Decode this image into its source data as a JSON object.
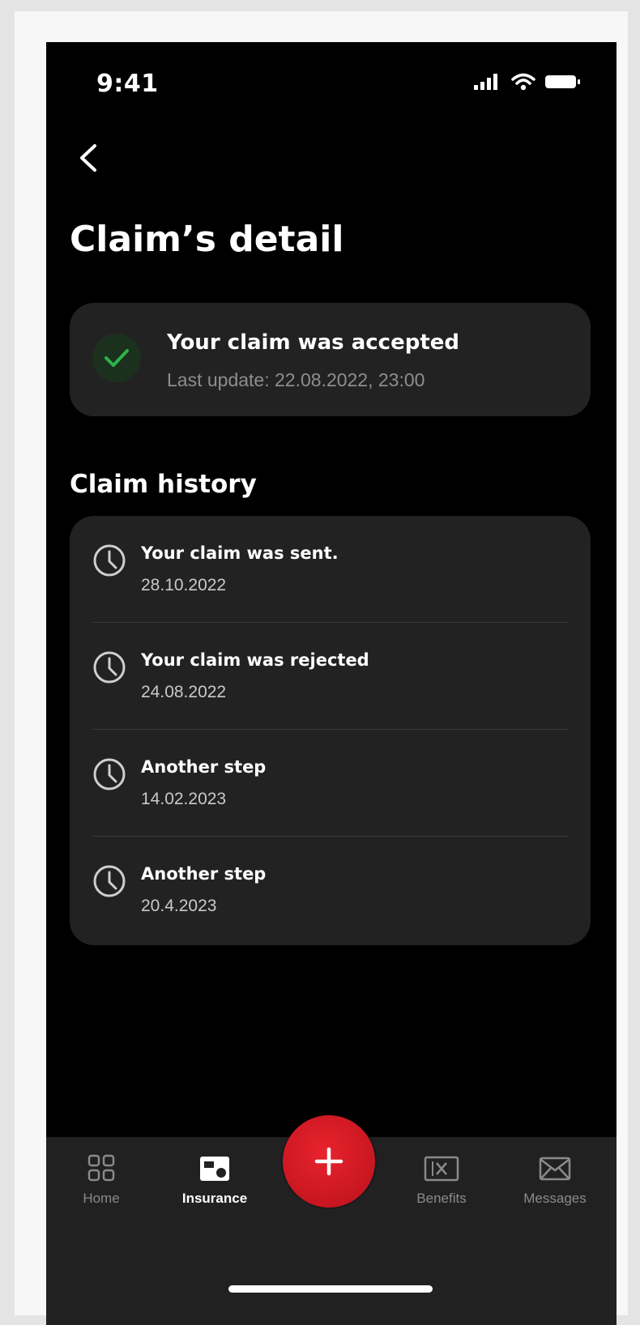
{
  "status_bar": {
    "time": "9:41"
  },
  "header": {
    "title": "Claim’s detail"
  },
  "claim_status": {
    "title": "Your claim was accepted",
    "subtitle": "Last update: 22.08.2022, 23:00",
    "icon": "check-icon",
    "accent": "#2bb44a"
  },
  "history": {
    "title": "Claim history",
    "items": [
      {
        "title": "Your claim was sent.",
        "date": "28.10.2022",
        "icon": "clock-icon"
      },
      {
        "title": "Your claim was rejected",
        "date": "24.08.2022",
        "icon": "clock-icon"
      },
      {
        "title": "Another step",
        "date": "14.02.2023",
        "icon": "clock-icon"
      },
      {
        "title": "Another step",
        "date": "20.4.2023",
        "icon": "clock-icon"
      }
    ]
  },
  "tabbar": {
    "items": [
      {
        "label": "Home",
        "icon": "grid-icon",
        "active": false
      },
      {
        "label": "Insurance",
        "icon": "insurance-icon",
        "active": true
      },
      {
        "label": "Benefits",
        "icon": "benefits-icon",
        "active": false
      },
      {
        "label": "Messages",
        "icon": "envelope-icon",
        "active": false
      }
    ],
    "fab_icon": "plus-icon",
    "fab_color": "#d41c24"
  }
}
